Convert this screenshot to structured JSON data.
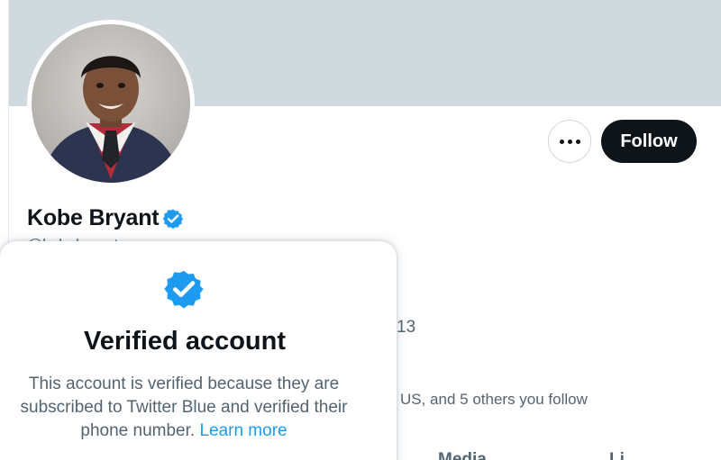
{
  "profile": {
    "display_name": "Kobe Bryant",
    "handle": "@kobebryant",
    "verified_badge_icon": "verified-badge-icon",
    "avatar_icon": "profile-photo",
    "colors": {
      "banner": "#cfd9de",
      "badge_blue": "#1d9bf0",
      "follow_bg": "#0f1419",
      "muted_text": "#536471",
      "link": "#1d9bf0"
    }
  },
  "actions": {
    "more_icon": "more-horizontal-icon",
    "follow_label": "Follow"
  },
  "partial_text": {
    "joined_tail": "13",
    "followers_you_know": "US, and 5 others you follow",
    "tab_media": "Media",
    "tab_likes": "Li"
  },
  "popover": {
    "icon": "verified-badge-icon",
    "title": "Verified account",
    "body_line1": "This account is verified because they are",
    "body_line2": "subscribed to Twitter Blue and verified their",
    "body_line3": "phone number.",
    "learn_more": "Learn more"
  }
}
